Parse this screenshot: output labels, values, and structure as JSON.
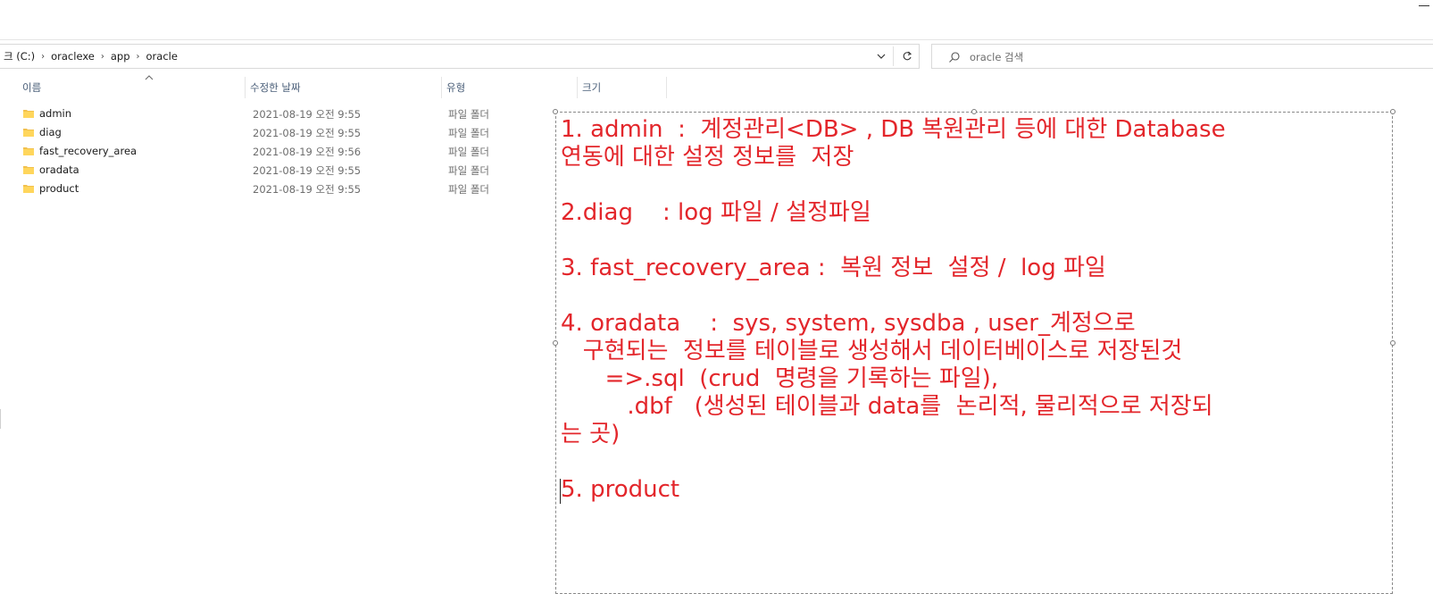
{
  "window": {
    "minimize_label": ""
  },
  "address": {
    "crumbs": [
      "크 (C:)",
      "oraclexe",
      "app",
      "oracle"
    ]
  },
  "search": {
    "placeholder": "oracle 검색"
  },
  "columns": {
    "name": "이름",
    "modified": "수정한 날짜",
    "type": "유형",
    "size": "크기"
  },
  "files": [
    {
      "name": "admin",
      "modified": "2021-08-19 오전 9:55",
      "type": "파일 폴더"
    },
    {
      "name": "diag",
      "modified": "2021-08-19 오전 9:55",
      "type": "파일 폴더"
    },
    {
      "name": "fast_recovery_area",
      "modified": "2021-08-19 오전 9:56",
      "type": "파일 폴더"
    },
    {
      "name": "oradata",
      "modified": "2021-08-19 오전 9:55",
      "type": "파일 폴더"
    },
    {
      "name": "product",
      "modified": "2021-08-19 오전 9:55",
      "type": "파일 폴더"
    }
  ],
  "note": {
    "color": "#e3262b",
    "lines": [
      "1. admin  :  계정관리<DB> , DB 복원관리 등에 대한 Database",
      "연동에 대한 설정 정보를  저장",
      "",
      "2.diag    : log 파일 / 설정파일",
      "",
      "3. fast_recovery_area :  복원 정보  설정 /  log 파일",
      "",
      "4. oradata    :  sys, system, sysdba , user_계정으로",
      "   구현되는  정보를 테이블로 생성해서 데이터베이스로 저장된것",
      "      =>.sql  (crud  명령을 기록하는 파일),",
      "         .dbf   (생성된 테이블과 data를  논리적, 물리적으로 저장되",
      "는 곳)",
      "",
      "5. product"
    ]
  },
  "icons": {
    "folder": "folder-icon",
    "refresh": "refresh-icon",
    "search": "search-icon",
    "dropdown": "chevron-down-icon",
    "sort": "sort-up-icon"
  }
}
